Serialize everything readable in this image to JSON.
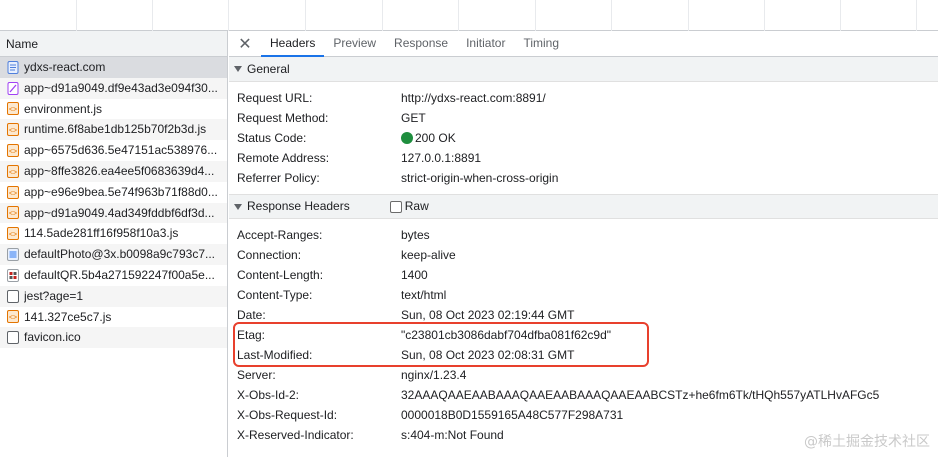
{
  "left_panel": {
    "column_header": "Name",
    "requests": [
      {
        "name": "ydxs-react.com",
        "icon": "document-icon",
        "selected": true
      },
      {
        "name": "app~d91a9049.df9e43ad3e094f30...",
        "icon": "stylesheet-icon"
      },
      {
        "name": "environment.js",
        "icon": "script-icon"
      },
      {
        "name": "runtime.6f8abe1db125b70f2b3d.js",
        "icon": "script-icon"
      },
      {
        "name": "app~6575d636.5e47151ac538976...",
        "icon": "script-icon"
      },
      {
        "name": "app~8ffe3826.ea4ee5f0683639d4...",
        "icon": "script-icon"
      },
      {
        "name": "app~e96e9bea.5e74f963b71f88d0...",
        "icon": "script-icon"
      },
      {
        "name": "app~d91a9049.4ad349fddbf6df3d...",
        "icon": "script-icon"
      },
      {
        "name": "114.5ade281ff16f958f10a3.js",
        "icon": "script-icon"
      },
      {
        "name": "defaultPhoto@3x.b0098a9c793c7...",
        "icon": "image-icon"
      },
      {
        "name": "defaultQR.5b4a271592247f00a5e...",
        "icon": "image-qr-icon"
      },
      {
        "name": "jest?age=1",
        "icon": "generic-file-icon"
      },
      {
        "name": "141.327ce5c7.js",
        "icon": "script-icon"
      },
      {
        "name": "favicon.ico",
        "icon": "generic-file-icon"
      }
    ]
  },
  "tabs": [
    "Headers",
    "Preview",
    "Response",
    "Initiator",
    "Timing"
  ],
  "active_tab": "Headers",
  "close_label": "✕",
  "general": {
    "title": "General",
    "rows": [
      {
        "key": "Request URL:",
        "value": "http://ydxs-react.com:8891/"
      },
      {
        "key": "Request Method:",
        "value": "GET"
      },
      {
        "key": "Status Code:",
        "value": "200 OK"
      },
      {
        "key": "Remote Address:",
        "value": "127.0.0.1:8891"
      },
      {
        "key": "Referrer Policy:",
        "value": "strict-origin-when-cross-origin"
      }
    ]
  },
  "response_headers": {
    "title": "Response Headers",
    "raw_label": "Raw",
    "rows": [
      {
        "key": "Accept-Ranges:",
        "value": "bytes"
      },
      {
        "key": "Connection:",
        "value": "keep-alive"
      },
      {
        "key": "Content-Length:",
        "value": "1400"
      },
      {
        "key": "Content-Type:",
        "value": "text/html"
      },
      {
        "key": "Date:",
        "value": "Sun, 08 Oct 2023 02:19:44 GMT"
      },
      {
        "key": "Etag:",
        "value": "\"c23801cb3086dabf704dfba081f62c9d\""
      },
      {
        "key": "Last-Modified:",
        "value": "Sun, 08 Oct 2023 02:08:31 GMT"
      },
      {
        "key": "Server:",
        "value": "nginx/1.23.4"
      },
      {
        "key": "X-Obs-Id-2:",
        "value": "32AAAQAAEAABAAAQAAEAABAAAQAAEAABCSTz+he6fm6Tk/tHQh557yATLHvAFGc5"
      },
      {
        "key": "X-Obs-Request-Id:",
        "value": "0000018B0D1559165A48C577F298A731"
      },
      {
        "key": "X-Reserved-Indicator:",
        "value": "s:404-m:Not Found"
      }
    ]
  },
  "watermark": "@稀土掘金技术社区",
  "colors": {
    "status_ok": "#1e8e3e",
    "highlight": "#e8402d",
    "active_tab": "#1a73e8"
  }
}
